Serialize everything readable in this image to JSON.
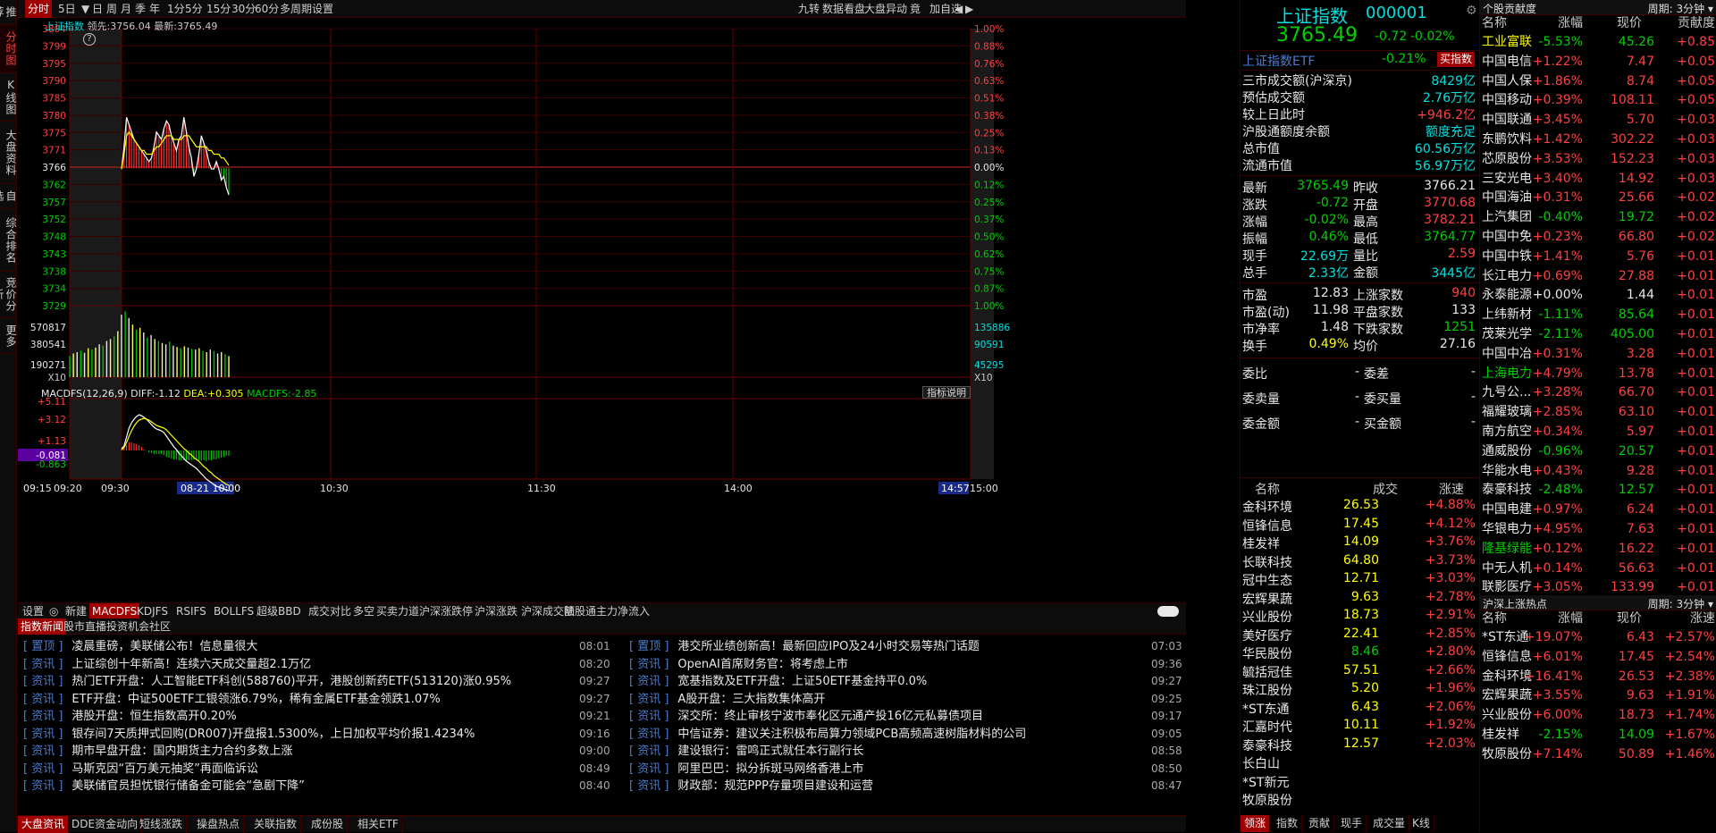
{
  "sidebar": {
    "tabs": [
      "推荐",
      "分时图",
      "K线图",
      "大盘资料",
      "自选股",
      "综合排名",
      "竞价分析",
      "更多"
    ]
  },
  "toolbar": {
    "left": [
      "分时",
      "5日",
      "▼",
      "日",
      "周",
      "月",
      "季",
      "年",
      "1分",
      "5分",
      "15分",
      "30分",
      "60分",
      "多周期",
      "设置"
    ],
    "right": [
      "九转",
      "数据看盘",
      "大盘异动",
      "竟",
      "加自选",
      "◀",
      "▶"
    ]
  },
  "chart": {
    "index_name": "上证指数",
    "lead_label": "领先:",
    "lead_value": "3756.04",
    "latest_label": "最新:",
    "latest_value": "3765.49",
    "help_mark": "?",
    "y_left": [
      "3804",
      "3799",
      "3795",
      "3790",
      "3785",
      "3780",
      "3775",
      "3771",
      "3766",
      "3762",
      "3757",
      "3752",
      "3748",
      "3743",
      "3738",
      "3734",
      "3729"
    ],
    "y_right": [
      "1.00%",
      "0.88%",
      "0.76%",
      "0.63%",
      "0.51%",
      "0.38%",
      "0.25%",
      "0.13%",
      "0.00%",
      "0.12%",
      "0.25%",
      "0.37%",
      "0.50%",
      "0.62%",
      "0.75%",
      "0.87%",
      "1.00%"
    ],
    "vol_left": [
      "570817",
      "380541",
      "190271",
      "X10"
    ],
    "vol_right": [
      "135886",
      "90591",
      "45295",
      "X10"
    ],
    "macd_caption": "MACDFS(12,26,9)",
    "diff_label": "DIFF:",
    "diff_value": "-1.12",
    "dea_label": "DEA:",
    "dea_value": "+0.305",
    "macdfs_label": "MACDFS:",
    "macdfs_value": "-2.85",
    "indicator_help": "指标说明",
    "macd_left": [
      "+5.11",
      "+3.12",
      "+1.13",
      "-0.081",
      "-0.863"
    ],
    "x_labels": [
      "09:15",
      "09:20",
      "09:30",
      "10:30",
      "11:30",
      "14:00",
      "15:00"
    ],
    "cursor_time": "08-21 10:00",
    "end_time": "14:57",
    "prev_close": 3766.21,
    "y_max": 3804,
    "y_min": 3729,
    "price": [
      3766,
      3772,
      3780,
      3778,
      3776,
      3774,
      3773,
      3772,
      3771,
      3770,
      3769,
      3768,
      3769,
      3772,
      3776,
      3775,
      3774,
      3777,
      3779,
      3778,
      3775,
      3773,
      3771,
      3774,
      3775,
      3780,
      3776,
      3772,
      3769,
      3764,
      3766,
      3770,
      3775,
      3773,
      3771,
      3768,
      3766,
      3766,
      3768,
      3766,
      3763,
      3764,
      3761,
      3759
    ],
    "avg": [
      3766,
      3770,
      3775,
      3776,
      3775,
      3774,
      3773,
      3772,
      3771,
      3771,
      3770,
      3770,
      3770,
      3771,
      3772,
      3772,
      3773,
      3774,
      3775,
      3775,
      3775,
      3774,
      3774,
      3774,
      3774,
      3775,
      3775,
      3775,
      3774,
      3773,
      3772,
      3772,
      3772,
      3772,
      3772,
      3771,
      3771,
      3770,
      3770,
      3770,
      3769,
      3769,
      3768,
      3767
    ],
    "volume": [
      0.32,
      0.36,
      0.38,
      0.4,
      0.37,
      0.44,
      0.42,
      0.45,
      0.5,
      0.48,
      0.55,
      0.58,
      0.62,
      0.7,
      0.95,
      1.0,
      0.9,
      0.8,
      0.72,
      0.75,
      0.68,
      0.6,
      0.64,
      0.58,
      0.55,
      0.52,
      0.5,
      0.54,
      0.48,
      0.46,
      0.44,
      0.47,
      0.45,
      0.43,
      0.42,
      0.44,
      0.4,
      0.38,
      0.42,
      0.4,
      0.36,
      0.38,
      0.35,
      0.32
    ],
    "macd_diff": [
      0.2,
      0.5,
      1.5,
      2.5,
      3.1,
      3.5,
      3.8,
      4.0,
      3.9,
      3.7,
      3.5,
      3.2,
      2.9,
      2.6,
      2.4,
      2.3,
      2.2,
      2.0,
      1.6,
      1.2,
      0.8,
      0.4,
      0.1,
      -0.3,
      -0.6,
      -0.9,
      -1.2,
      -1.4,
      -1.6,
      -1.8,
      -2.0,
      -2.3,
      -2.6,
      -2.9,
      -3.2,
      -3.4,
      -3.6,
      -3.8,
      -4.0,
      -4.1,
      -4.2,
      -4.3,
      -4.4,
      -4.5
    ],
    "macd_dea": [
      0.1,
      0.3,
      0.9,
      1.6,
      2.2,
      2.7,
      3.1,
      3.4,
      3.5,
      3.6,
      3.5,
      3.4,
      3.2,
      3.0,
      2.8,
      2.7,
      2.6,
      2.5,
      2.3,
      2.0,
      1.7,
      1.4,
      1.1,
      0.8,
      0.5,
      0.2,
      0.0,
      -0.3,
      -0.5,
      -0.8,
      -1.0,
      -1.2,
      -1.5,
      -1.8,
      -2.0,
      -2.3,
      -2.5,
      -2.8,
      -3.0,
      -3.2,
      -3.4,
      -3.6,
      -3.8,
      -3.9
    ],
    "macd_bars": [
      0.1,
      0.2,
      0.6,
      0.9,
      0.9,
      0.8,
      0.7,
      0.6,
      0.4,
      0.1,
      0.0,
      -0.2,
      -0.3,
      -0.4,
      -0.4,
      -0.4,
      -0.4,
      -0.5,
      -0.7,
      -0.8,
      -0.9,
      -1.0,
      -1.0,
      -1.1,
      -1.1,
      -1.1,
      -1.2,
      -1.1,
      -1.1,
      -1.0,
      -1.0,
      -1.1,
      -1.1,
      -1.1,
      -1.2,
      -1.1,
      -1.1,
      -1.0,
      -1.0,
      -0.9,
      -0.8,
      -0.7,
      -0.6,
      -0.6
    ]
  },
  "indicator_tabs": [
    "设置",
    "◎",
    "新建",
    "MACDFS",
    "KDJFS",
    "RSIFS",
    "BOLLFS",
    "超级BBD",
    "成交对比",
    "多空",
    "买卖力道",
    "沪深涨跌停",
    "沪深涨跌",
    "沪深成交额",
    "陆股通主力净流入"
  ],
  "news_tabs": [
    "指数新闻",
    "股市直播",
    "投资机会",
    "社区"
  ],
  "news_left": [
    {
      "tag": "[ 置顶 ]",
      "text": "凌晨重磅，美联储公布！信息量很大",
      "time": "08:01"
    },
    {
      "tag": "[ 资讯 ]",
      "text": "上证综创十年新高！连续六天成交量超2.1万亿",
      "time": "08:20"
    },
    {
      "tag": "[ 资讯 ]",
      "text": "热门ETF开盘：人工智能ETF科创(588760)平开，港股创新药ETF(513120)涨0.95%",
      "time": "09:27"
    },
    {
      "tag": "[ 资讯 ]",
      "text": "ETF开盘：中证500ETF工银领涨6.79%，稀有金属ETF基金领跌1.07%",
      "time": "09:27"
    },
    {
      "tag": "[ 资讯 ]",
      "text": "港股开盘：恒生指数高开0.20%",
      "time": "09:21"
    },
    {
      "tag": "[ 资讯 ]",
      "text": "银存间7天质押式回购(DR007)开盘报1.5300%，上日加权平均价报1.4234%",
      "time": "09:16"
    },
    {
      "tag": "[ 资讯 ]",
      "text": "期市早盘开盘：国内期货主力合约多数上涨",
      "time": "09:00"
    },
    {
      "tag": "[ 资讯 ]",
      "text": "马斯克因“百万美元抽奖”再面临诉讼",
      "time": "08:49"
    },
    {
      "tag": "[ 资讯 ]",
      "text": "美联储官员担忧银行储备金可能会“急剧下降”",
      "time": "08:40"
    }
  ],
  "news_right": [
    {
      "tag": "[ 置顶 ]",
      "text": "港交所业绩创新高！最新回应IPO及24小时交易等热门话题",
      "time": "07:03"
    },
    {
      "tag": "[ 资讯 ]",
      "text": "OpenAI首席财务官：将考虑上市",
      "time": "09:36"
    },
    {
      "tag": "[ 资讯 ]",
      "text": "宽基指数及ETF开盘：上证50ETF基金持平0.0%",
      "time": "09:27"
    },
    {
      "tag": "[ 资讯 ]",
      "text": "A股开盘：三大指数集体高开",
      "time": "09:25"
    },
    {
      "tag": "[ 资讯 ]",
      "text": "深交所：终止审核宁波市奉化区元通产投16亿元私募债项目",
      "time": "09:17"
    },
    {
      "tag": "[ 资讯 ]",
      "text": "中信证券：建议关注积极布局算力领域PCB高频高速树脂材料的公司",
      "time": "09:05"
    },
    {
      "tag": "[ 资讯 ]",
      "text": "建设银行：雷鸣正式就任本行副行长",
      "time": "08:58"
    },
    {
      "tag": "[ 资讯 ]",
      "text": "阿里巴巴：拟分拆斑马网络香港上市",
      "time": "08:50"
    },
    {
      "tag": "[ 资讯 ]",
      "text": "财政部：规范PPP存量项目建设和运营",
      "time": "08:47"
    }
  ],
  "bottom_tabs": [
    "大盘资讯",
    "DDE资金动向",
    "短线涨跌",
    "操盘热点",
    "关联指数",
    "成份股",
    "相关ETF"
  ],
  "quote": {
    "title": "上证指数",
    "code": "000001",
    "price": "3765.49",
    "change": "-0.72",
    "pct": "-0.02%",
    "etf_name": "上证指数ETF",
    "etf_pct": "-0.21%",
    "etf_btn": "买指数",
    "rows1": [
      [
        "三市成交额(沪深京)",
        "8429亿"
      ],
      [
        "预估成交额",
        "2.76万亿"
      ],
      [
        "较上日此时",
        "+946.2亿"
      ],
      [
        "沪股通额度余额",
        "额度充足"
      ],
      [
        "总市值",
        "60.56万亿"
      ],
      [
        "流通市值",
        "56.97万亿"
      ]
    ],
    "rows2": [
      [
        "最新",
        "3765.49",
        "昨收",
        "3766.21"
      ],
      [
        "涨跌",
        "-0.72",
        "开盘",
        "3770.68"
      ],
      [
        "涨幅",
        "-0.02%",
        "最高",
        "3782.21"
      ],
      [
        "振幅",
        "0.46%",
        "最低",
        "3764.77"
      ],
      [
        "现手",
        "22.69万",
        "量比",
        "2.59"
      ],
      [
        "总手",
        "2.33亿",
        "金额",
        "3445亿"
      ]
    ],
    "rows3": [
      [
        "市盈",
        "12.83",
        "上涨家数",
        "940"
      ],
      [
        "市盈(动)",
        "11.98",
        "平盘家数",
        "133"
      ],
      [
        "市净率",
        "1.48",
        "下跌家数",
        "1251"
      ],
      [
        "换手",
        "0.49%",
        "均价",
        "27.16"
      ]
    ],
    "rows4": [
      [
        "委比",
        "-",
        "委差",
        "-"
      ],
      [
        "委卖量",
        "-",
        "委买量",
        "-"
      ],
      [
        "委金额",
        "-",
        "买金额",
        "-"
      ]
    ],
    "stocks_header": [
      "名称",
      "成交",
      "涨速"
    ],
    "stocks": [
      [
        "金科环境",
        "26.53",
        "+4.88%"
      ],
      [
        "恒锋信息",
        "17.45",
        "+4.12%"
      ],
      [
        "桂发祥",
        "14.09",
        "+3.76%"
      ],
      [
        "长联科技",
        "64.80",
        "+3.73%"
      ],
      [
        "冠中生态",
        "12.71",
        "+3.03%"
      ],
      [
        "宏辉果蔬",
        "9.63",
        "+2.78%"
      ],
      [
        "兴业股份",
        "18.73",
        "+2.91%"
      ],
      [
        "美好医疗",
        "22.41",
        "+2.85%"
      ],
      [
        "华民股份",
        "8.46",
        "+2.80%"
      ],
      [
        "毓括冠佳",
        "57.51",
        "+2.66%"
      ],
      [
        "珠江股份",
        "5.20",
        "+1.96%"
      ],
      [
        "*ST东通",
        "6.43",
        "+2.06%"
      ],
      [
        "汇嘉时代",
        "10.11",
        "+1.92%"
      ],
      [
        "泰豪科技",
        "12.57",
        "+2.03%"
      ],
      [
        "长白山",
        "",
        ""
      ],
      [
        "*ST新元",
        "",
        ""
      ],
      [
        "牧原股份",
        "",
        ""
      ]
    ],
    "tabs": [
      "领涨",
      "指数",
      "贡献",
      "现手",
      "成交量",
      "K线"
    ]
  },
  "rpanel": {
    "head1": "个股贡献度",
    "period1": "周期: 3分钟 ▾",
    "cols": [
      "名称",
      "涨幅",
      "现价",
      "贡献度"
    ],
    "list1": [
      [
        "工业富联",
        "-5.53%",
        "45.26",
        "+0.85"
      ],
      [
        "中国电信",
        "+1.22%",
        "7.47",
        "+0.05"
      ],
      [
        "中国人保",
        "+1.86%",
        "8.74",
        "+0.05"
      ],
      [
        "中国移动",
        "+0.39%",
        "108.11",
        "+0.05"
      ],
      [
        "中国联通",
        "+3.45%",
        "5.70",
        "+0.03"
      ],
      [
        "东鹏饮料",
        "+1.42%",
        "302.22",
        "+0.03"
      ],
      [
        "芯原股份",
        "+3.53%",
        "152.23",
        "+0.03"
      ],
      [
        "三安光电",
        "+3.40%",
        "14.92",
        "+0.03"
      ],
      [
        "中国海油",
        "+0.31%",
        "25.66",
        "+0.02"
      ],
      [
        "上汽集团",
        "-0.40%",
        "19.72",
        "+0.02"
      ],
      [
        "中国中免",
        "+0.23%",
        "66.80",
        "+0.02"
      ],
      [
        "中国中铁",
        "+1.41%",
        "5.76",
        "+0.01"
      ],
      [
        "长江电力",
        "+0.69%",
        "27.88",
        "+0.01"
      ],
      [
        "永泰能源",
        "+0.00%",
        "1.44",
        "+0.01"
      ],
      [
        "上纬新材",
        "-1.11%",
        "85.64",
        "+0.01"
      ],
      [
        "茂莱光学",
        "-2.11%",
        "405.00",
        "+0.01"
      ],
      [
        "中国中冶",
        "+0.31%",
        "3.28",
        "+0.01"
      ],
      [
        "上海电力",
        "+4.79%",
        "13.78",
        "+0.01"
      ],
      [
        "九号公...",
        "+3.28%",
        "66.70",
        "+0.01"
      ],
      [
        "福耀玻璃",
        "+2.85%",
        "63.10",
        "+0.01"
      ],
      [
        "南方航空",
        "+0.34%",
        "5.97",
        "+0.01"
      ],
      [
        "通威股份",
        "-0.96%",
        "20.57",
        "+0.01"
      ],
      [
        "华能水电",
        "+0.43%",
        "9.28",
        "+0.01"
      ],
      [
        "泰豪科技",
        "-2.48%",
        "12.57",
        "+0.01"
      ],
      [
        "中国电建",
        "+0.97%",
        "6.24",
        "+0.01"
      ],
      [
        "华银电力",
        "+4.95%",
        "7.63",
        "+0.01"
      ],
      [
        "隆基绿能",
        "+0.12%",
        "16.22",
        "+0.01"
      ],
      [
        "中无人机",
        "+0.14%",
        "56.63",
        "+0.01"
      ],
      [
        "联影医疗",
        "+3.05%",
        "133.99",
        "+0.01"
      ]
    ],
    "head2": "沪深上涨热点",
    "period2": "周期: 3分钟 ▾",
    "cols2": [
      "名称",
      "涨幅",
      "现价",
      "涨速"
    ],
    "list2": [
      [
        "*ST东通",
        "+19.07%",
        "6.43",
        "+2.57%"
      ],
      [
        "恒锋信息",
        "+6.01%",
        "17.45",
        "+2.54%"
      ],
      [
        "金科环境",
        "+16.41%",
        "26.53",
        "+2.38%"
      ],
      [
        "宏辉果蔬",
        "+3.55%",
        "9.63",
        "+1.91%"
      ],
      [
        "兴业股份",
        "+6.00%",
        "18.73",
        "+1.74%"
      ],
      [
        "桂发祥",
        "-2.15%",
        "14.09",
        "+1.67%"
      ],
      [
        "牧原股份",
        "+7.14%",
        "50.89",
        "+1.46%"
      ]
    ]
  }
}
